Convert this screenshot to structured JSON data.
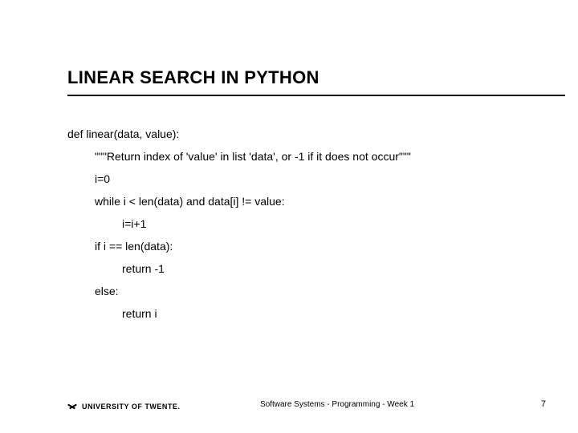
{
  "title": "LINEAR SEARCH IN PYTHON",
  "code": {
    "l0": "def linear(data, value):",
    "l1": "\"\"\"Return index of 'value' in list 'data', or -1 if it does not occur\"\"\"",
    "l2": "i=0",
    "l3": "while i < len(data) and data[i] != value:",
    "l4": "i=i+1",
    "l5": "if i == len(data):",
    "l6": "return -1",
    "l7": "else:",
    "l8": "return i"
  },
  "footer": {
    "org": "UNIVERSITY OF TWENTE.",
    "center": "Software Systems - Programming - Week 1",
    "page": "7"
  }
}
